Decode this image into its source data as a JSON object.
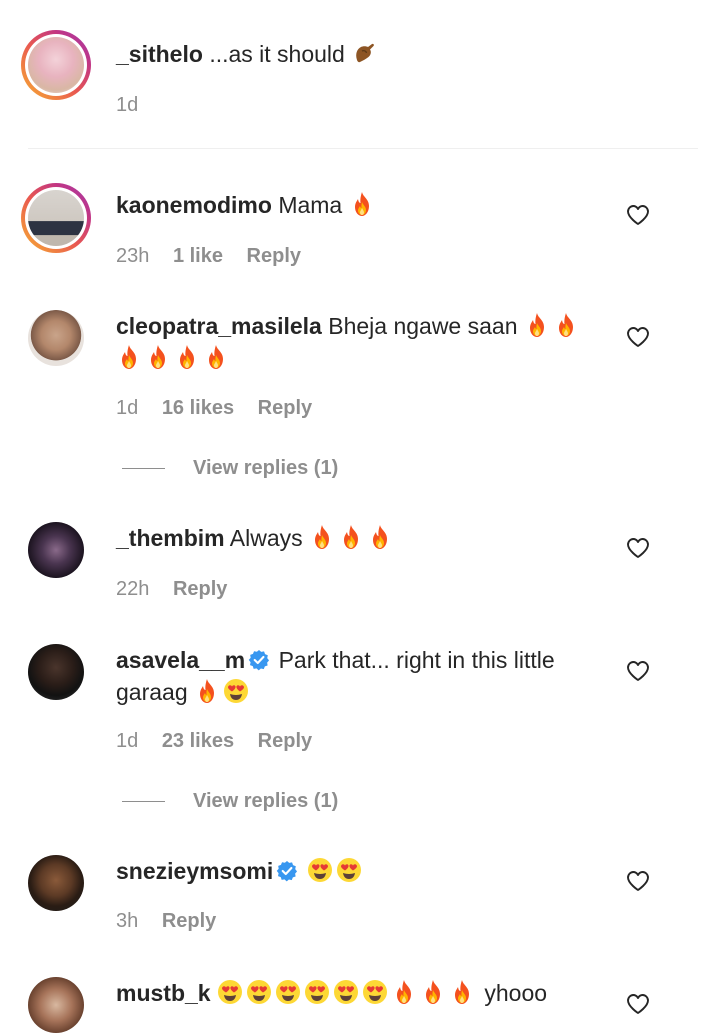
{
  "comments": [
    {
      "username": "_sithelo",
      "text": "...as it should",
      "emoji": [
        "pinch"
      ],
      "time": "1d",
      "likes": "",
      "reply": ""
    },
    {
      "username": "kaonemodimo",
      "text": "Mama",
      "emoji": [
        "fire"
      ],
      "time": "23h",
      "likes": "1 like",
      "reply": "Reply"
    },
    {
      "username": "cleopatra_masilela",
      "text": "Bheja ngawe saan",
      "emoji": [
        "fire",
        "fire",
        "fire",
        "fire",
        "fire",
        "fire"
      ],
      "time": "1d",
      "likes": "16 likes",
      "reply": "Reply",
      "view_replies": "View replies (1)"
    },
    {
      "username": "_thembim",
      "text": "Always",
      "emoji": [
        "fire",
        "fire",
        "fire"
      ],
      "time": "22h",
      "likes": "",
      "reply": "Reply"
    },
    {
      "username": "asavela__m",
      "text": "Park that... right in this little garaag",
      "emoji": [
        "fire",
        "hearteyes"
      ],
      "time": "1d",
      "likes": "23 likes",
      "reply": "Reply",
      "view_replies": "View replies (1)"
    },
    {
      "username": "snezieymsomi",
      "text": "",
      "emoji": [
        "hearteyes",
        "hearteyes"
      ],
      "time": "3h",
      "likes": "",
      "reply": "Reply"
    },
    {
      "username": "mustb_k",
      "text": "yhooo",
      "emoji": [
        "hearteyes",
        "hearteyes",
        "hearteyes",
        "hearteyes",
        "hearteyes",
        "hearteyes",
        "fire",
        "fire",
        "fire"
      ]
    }
  ],
  "icons": {
    "like": "heart-outline-icon",
    "verified": "verified-badge-icon"
  },
  "colors": {
    "text": "#262626",
    "secondary": "#8e8e8e",
    "verified": "#3897f0"
  }
}
